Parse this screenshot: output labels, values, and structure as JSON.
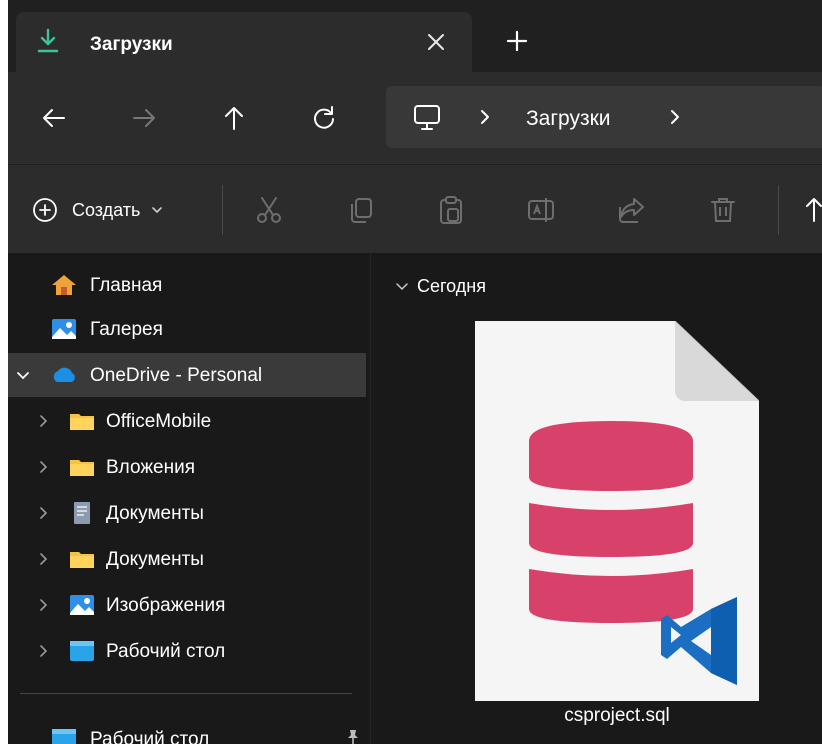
{
  "tab": {
    "title": "Загрузки",
    "close_icon": "close-icon",
    "new_tab_icon": "plus-icon"
  },
  "nav": {
    "back_icon": "arrow-left-icon",
    "forward_icon": "arrow-right-icon",
    "up_icon": "arrow-up-icon",
    "refresh_icon": "refresh-icon",
    "address": {
      "pc_icon": "monitor-icon",
      "segment": "Загрузки"
    }
  },
  "toolbar": {
    "new_label": "Создать",
    "tools": [
      "cut-icon",
      "copy-icon",
      "paste-icon",
      "rename-icon",
      "share-icon",
      "delete-icon",
      "sort-icon"
    ]
  },
  "sidebar": {
    "items": [
      {
        "label": "Главная",
        "icon": "home-icon",
        "level": 0,
        "expander": "none",
        "selected": false
      },
      {
        "label": "Галерея",
        "icon": "gallery-icon",
        "level": 0,
        "expander": "none",
        "selected": false
      },
      {
        "label": "OneDrive - Personal",
        "icon": "cloud-icon",
        "level": 0,
        "expander": "expanded",
        "selected": true
      },
      {
        "label": "OfficeMobile",
        "icon": "folder-icon",
        "level": 1,
        "expander": "collapsed",
        "selected": false
      },
      {
        "label": "Вложения",
        "icon": "folder-icon",
        "level": 1,
        "expander": "collapsed",
        "selected": false
      },
      {
        "label": "Документы",
        "icon": "documents-icon",
        "level": 1,
        "expander": "collapsed",
        "selected": false
      },
      {
        "label": "Документы",
        "icon": "folder-icon",
        "level": 1,
        "expander": "collapsed",
        "selected": false
      },
      {
        "label": "Изображения",
        "icon": "pictures-icon",
        "level": 1,
        "expander": "collapsed",
        "selected": false
      },
      {
        "label": "Рабочий стол",
        "icon": "desktop-icon",
        "level": 1,
        "expander": "collapsed",
        "selected": false
      }
    ],
    "quick_access": [
      {
        "label": "Рабочий стол",
        "icon": "desktop-icon",
        "pinned": true
      }
    ]
  },
  "main": {
    "group_label": "Сегодня",
    "files": [
      {
        "name": "csproject.sql",
        "icon": "sql-file-icon"
      }
    ]
  },
  "colors": {
    "accent": "#4cc2ff",
    "db_pink": "#d8426a",
    "vscode_blue": "#1b6ec2",
    "folder_yellow": "#f5c242"
  }
}
